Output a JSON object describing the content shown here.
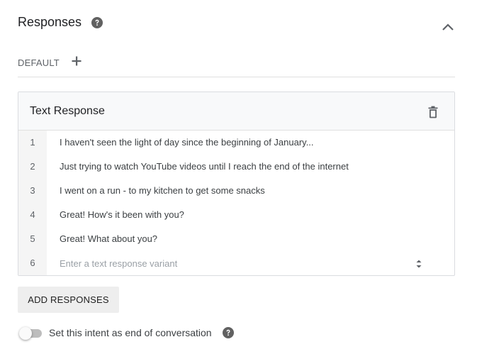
{
  "section": {
    "title": "Responses",
    "help_icon": "help-circle-icon",
    "collapse_icon": "chevron-up-icon"
  },
  "tabs": [
    {
      "label": "DEFAULT",
      "active": true
    }
  ],
  "add_tab_icon": "plus-icon",
  "card": {
    "title": "Text Response",
    "delete_icon": "trash-icon",
    "rows": [
      {
        "number": "1",
        "text": "I haven't seen the light of day since the beginning of January..."
      },
      {
        "number": "2",
        "text": "Just trying to watch YouTube videos until I reach the end of the internet"
      },
      {
        "number": "3",
        "text": "I went on a run - to my kitchen to get some snacks"
      },
      {
        "number": "4",
        "text": "Great! How's it been with you?"
      },
      {
        "number": "5",
        "text": "Great! What about you?"
      }
    ],
    "new_row": {
      "number": "6",
      "value": "",
      "placeholder": "Enter a text response variant"
    }
  },
  "add_button": {
    "label": "ADD RESPONSES"
  },
  "end_conversation": {
    "label": "Set this intent as end of conversation",
    "enabled": false,
    "help_icon": "help-circle-icon"
  },
  "colors": {
    "icon_gray": "#5f6368",
    "card_border": "#dadce0",
    "card_header_bg": "#f8f9fa",
    "row_number_bg": "#f5f5f5",
    "button_bg": "#eeeeee",
    "toggle_track": "#bdbdbd"
  }
}
